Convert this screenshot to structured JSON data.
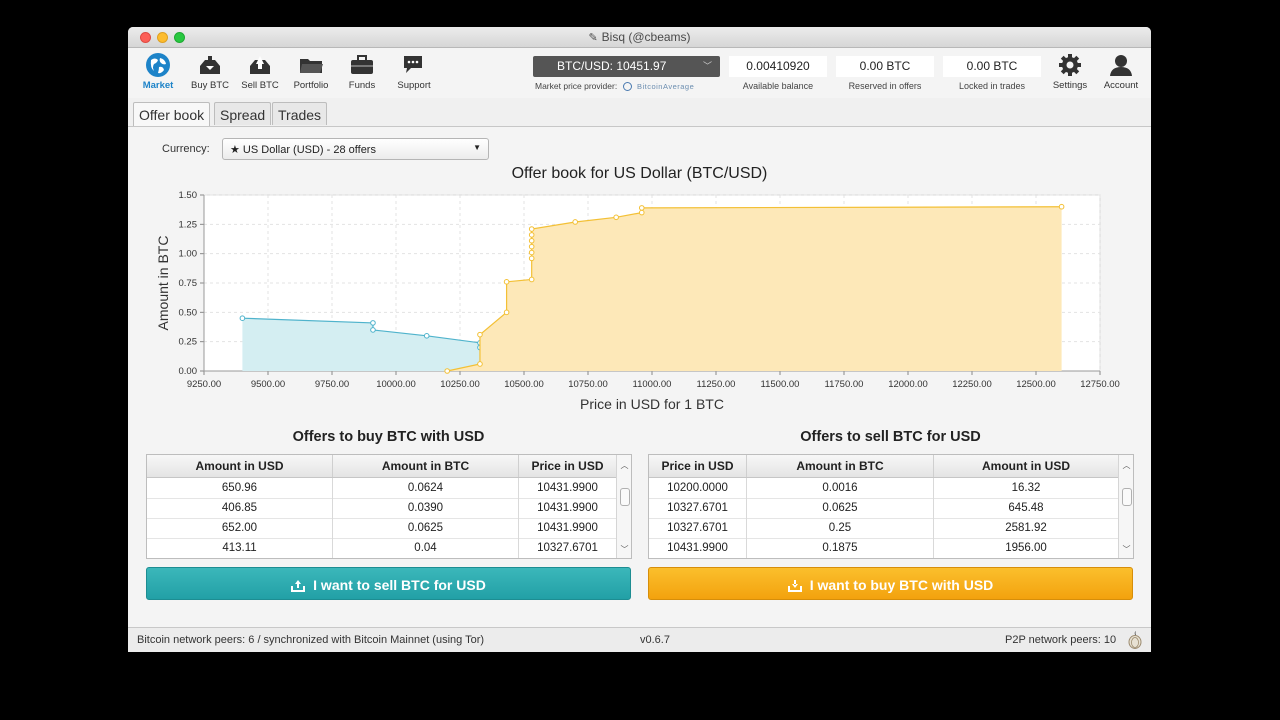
{
  "window": {
    "title": "Bisq (@cbeams)"
  },
  "nav": [
    {
      "label": "Market",
      "icon": "market-globe-icon",
      "active": true
    },
    {
      "label": "Buy BTC",
      "icon": "buy-btc-icon"
    },
    {
      "label": "Sell BTC",
      "icon": "sell-btc-icon"
    },
    {
      "label": "Portfolio",
      "icon": "portfolio-folder-icon"
    },
    {
      "label": "Funds",
      "icon": "funds-briefcase-icon"
    },
    {
      "label": "Support",
      "icon": "support-chat-icon"
    }
  ],
  "market": {
    "price_label": "BTC/USD: 10451.97",
    "provider_label": "Market price provider:",
    "provider_name": "BitcoinAverage"
  },
  "balances": {
    "available": {
      "value": "0.00410920",
      "label": "Available balance"
    },
    "reserved": {
      "value": "0.00 BTC",
      "label": "Reserved in offers"
    },
    "locked": {
      "value": "0.00 BTC",
      "label": "Locked in trades"
    }
  },
  "settings": {
    "label": "Settings",
    "icon": "settings-gear-icon"
  },
  "account": {
    "label": "Account",
    "icon": "account-user-icon"
  },
  "tabs": [
    {
      "label": "Offer book",
      "active": true
    },
    {
      "label": "Spread"
    },
    {
      "label": "Trades"
    }
  ],
  "currency": {
    "label": "Currency:",
    "value": "★ US Dollar (USD) - 28 offers"
  },
  "chart_data": {
    "type": "area",
    "title": "Offer book for US Dollar (BTC/USD)",
    "xlabel": "Price in USD for 1 BTC",
    "ylabel": "Amount in BTC",
    "xlim": [
      9250,
      12750
    ],
    "ylim": [
      0,
      1.5
    ],
    "x_ticks": [
      "9250.00",
      "9500.00",
      "9750.00",
      "10000.00",
      "10250.00",
      "10500.00",
      "10750.00",
      "11000.00",
      "11250.00",
      "11500.00",
      "11750.00",
      "12000.00",
      "12250.00",
      "12500.00",
      "12750.00"
    ],
    "y_ticks": [
      "0.00",
      "0.25",
      "0.50",
      "0.75",
      "1.00",
      "1.25",
      "1.50"
    ],
    "grid": true,
    "series": [
      {
        "color": "#4fb3cc",
        "fill": "#d4eef2",
        "points": [
          [
            9400,
            0.45
          ],
          [
            9910,
            0.41
          ],
          [
            9910,
            0.35
          ],
          [
            10120,
            0.3
          ],
          [
            10328,
            0.24
          ],
          [
            10328,
            0.2
          ],
          [
            10432,
            0.17
          ],
          [
            10432,
            0.11
          ],
          [
            10432,
            0.06
          ]
        ]
      },
      {
        "color": "#f3c035",
        "fill": "#fde8b8",
        "points": [
          [
            10200,
            0.0
          ],
          [
            10328,
            0.06
          ],
          [
            10328,
            0.31
          ],
          [
            10432,
            0.5
          ],
          [
            10432,
            0.76
          ],
          [
            10530,
            0.78
          ],
          [
            10530,
            0.96
          ],
          [
            10530,
            1.01
          ],
          [
            10530,
            1.06
          ],
          [
            10530,
            1.11
          ],
          [
            10530,
            1.16
          ],
          [
            10530,
            1.21
          ],
          [
            10700,
            1.27
          ],
          [
            10860,
            1.31
          ],
          [
            10960,
            1.35
          ],
          [
            10960,
            1.39
          ],
          [
            12600,
            1.4
          ]
        ]
      }
    ]
  },
  "buy_table": {
    "title": "Offers to buy BTC with USD",
    "columns": [
      "Amount in USD",
      "Amount in BTC",
      "Price in USD"
    ],
    "rows": [
      [
        "650.96",
        "0.0624",
        "10431.9900"
      ],
      [
        "406.85",
        "0.0390",
        "10431.9900"
      ],
      [
        "652.00",
        "0.0625",
        "10431.9900"
      ],
      [
        "413.11",
        "0.04",
        "10327.6701"
      ]
    ]
  },
  "sell_table": {
    "title": "Offers to sell BTC for USD",
    "columns": [
      "Price in USD",
      "Amount in BTC",
      "Amount in USD"
    ],
    "rows": [
      [
        "10200.0000",
        "0.0016",
        "16.32"
      ],
      [
        "10327.6701",
        "0.0625",
        "645.48"
      ],
      [
        "10327.6701",
        "0.25",
        "2581.92"
      ],
      [
        "10431.9900",
        "0.1875",
        "1956.00"
      ]
    ]
  },
  "actions": {
    "sell_label": "I want to sell BTC for USD",
    "buy_label": "I want to buy BTC with USD",
    "sell_color": "#2aa9ad",
    "buy_color": "#f7b11c"
  },
  "status": {
    "network": "Bitcoin network peers: 6 / synchronized with Bitcoin Mainnet (using Tor)",
    "version": "v0.6.7",
    "p2p": "P2P network peers: 10",
    "tor_icon": "tor-onion-icon"
  }
}
